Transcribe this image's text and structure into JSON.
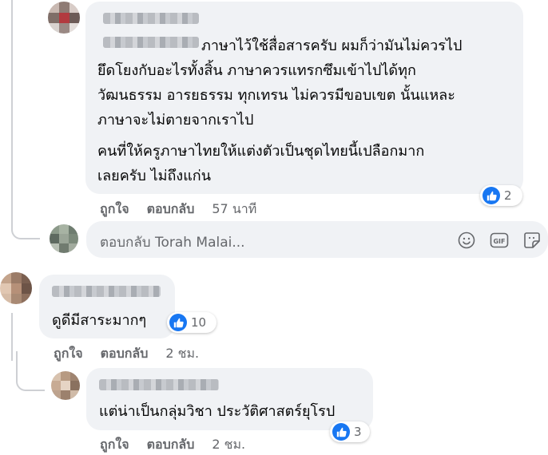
{
  "comments": [
    {
      "lines": [
        "ภาษาไว้ใช้สื่อสารครับ ผมก็ว่ามันไม่ควรไป",
        "ยึดโยงกับอะไรทั้งสิ้น ภาษาควรแทรกซึมเข้าไปได้ทุก",
        "วัฒนธรรม อารยธรรม ทุกเทรน ไม่ควรมีขอบเขต นั้นแหละ",
        "ภาษาจะไม่ตายจากเราไป",
        "คนที่ให้ครูภาษาไทยให้แต่งตัวเป็นชุดไทยนี้เปลือกมาก",
        "เลยครับ ไม่ถึงแก่น"
      ],
      "reaction_count": "2",
      "like_label": "ถูกใจ",
      "reply_label": "ตอบกลับ",
      "time": "57 นาที"
    },
    {
      "lines": [
        "ดูดีมีสาระมากๆ"
      ],
      "reaction_count": "10",
      "like_label": "ถูกใจ",
      "reply_label": "ตอบกลับ",
      "time": "2 ชม."
    },
    {
      "lines": [
        "แต่น่าเป็นกลุ่มวิชา ประวัติศาสตร์ยุโรป"
      ],
      "reaction_count": "3",
      "like_label": "ถูกใจ",
      "reply_label": "ตอบกลับ",
      "time": "2 ชม."
    }
  ],
  "reply_box": {
    "placeholder": "ตอบกลับ Torah Malai...",
    "icons": [
      "emoji-icon",
      "gif-icon",
      "sticker-icon"
    ]
  },
  "colors": {
    "bubble": "#f0f2f5",
    "like_blue": "#1877f2",
    "secondary_text": "#65676b"
  }
}
